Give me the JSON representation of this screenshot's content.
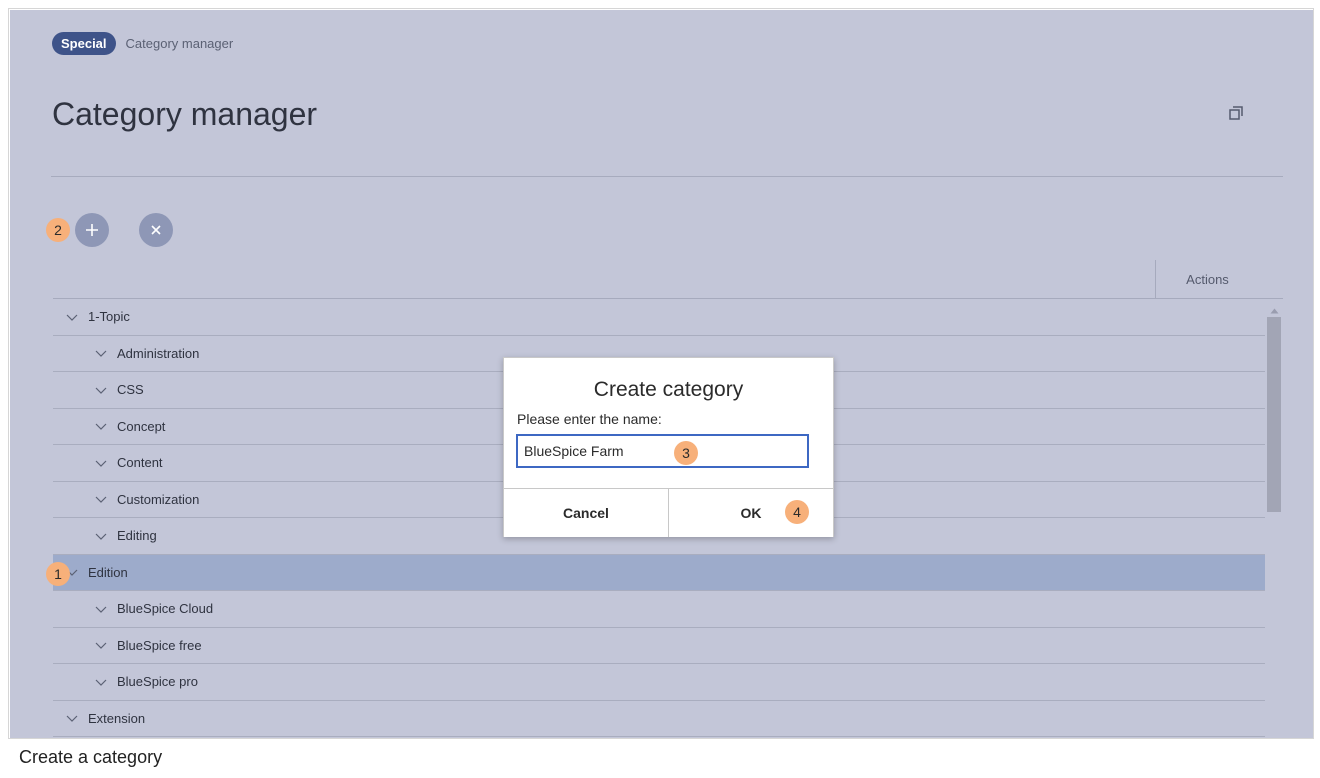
{
  "breadcrumb": {
    "namespace": "Special",
    "page": "Category manager"
  },
  "page": {
    "title": "Category manager"
  },
  "toolbar": {
    "add_icon": "plus-icon",
    "delete_icon": "close-icon"
  },
  "grid": {
    "actions_header": "Actions"
  },
  "tree": {
    "items": [
      {
        "label": "1-Topic",
        "level": 0
      },
      {
        "label": "Administration",
        "level": 1
      },
      {
        "label": "CSS",
        "level": 1
      },
      {
        "label": "Concept",
        "level": 1
      },
      {
        "label": "Content",
        "level": 1
      },
      {
        "label": "Customization",
        "level": 1
      },
      {
        "label": "Editing",
        "level": 1
      },
      {
        "label": "Edition",
        "level": 0,
        "selected": true
      },
      {
        "label": "BlueSpice Cloud",
        "level": 1
      },
      {
        "label": "BlueSpice free",
        "level": 1
      },
      {
        "label": "BlueSpice pro",
        "level": 1
      },
      {
        "label": "Extension",
        "level": 0
      }
    ]
  },
  "dialog": {
    "title": "Create category",
    "prompt": "Please enter the name:",
    "input_value": "BlueSpice Farm",
    "cancel_label": "Cancel",
    "ok_label": "OK"
  },
  "markers": {
    "m1": "1",
    "m2": "2",
    "m3": "3",
    "m4": "4"
  },
  "caption": "Create a category",
  "colors": {
    "accent": "#3e5389",
    "selected_row": "#9dabcb",
    "marker": "#f7b07a",
    "background": "#c3c6d8"
  }
}
